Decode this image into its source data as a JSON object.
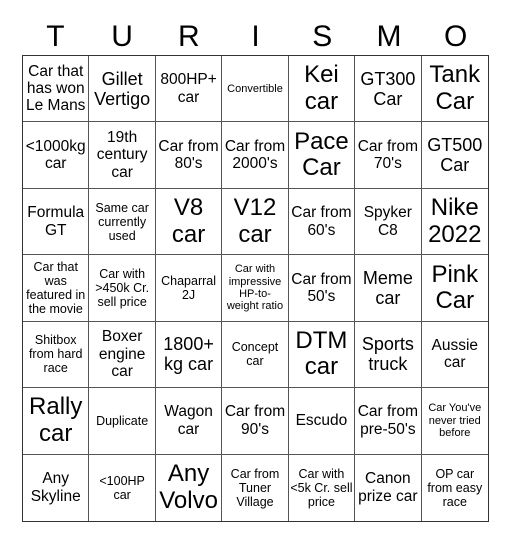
{
  "title_letters": [
    "T",
    "U",
    "R",
    "I",
    "S",
    "M",
    "O"
  ],
  "cells": [
    {
      "text": "Car that has won Le Mans",
      "size": "s-m"
    },
    {
      "text": "Gillet Vertigo",
      "size": "s-l"
    },
    {
      "text": "800HP+ car",
      "size": "s-m"
    },
    {
      "text": "Convertible",
      "size": "s-xs"
    },
    {
      "text": "Kei car",
      "size": "s-xl"
    },
    {
      "text": "GT300 Car",
      "size": "s-l"
    },
    {
      "text": "Tank Car",
      "size": "s-xl"
    },
    {
      "text": "<1000kg car",
      "size": "s-m"
    },
    {
      "text": "19th century car",
      "size": "s-m"
    },
    {
      "text": "Car from 80's",
      "size": "s-m"
    },
    {
      "text": "Car from 2000's",
      "size": "s-m"
    },
    {
      "text": "Pace Car",
      "size": "s-xl"
    },
    {
      "text": "Car from 70's",
      "size": "s-m"
    },
    {
      "text": "GT500 Car",
      "size": "s-l"
    },
    {
      "text": "Formula GT",
      "size": "s-m"
    },
    {
      "text": "Same car currently used",
      "size": "s-s"
    },
    {
      "text": "V8 car",
      "size": "s-xl"
    },
    {
      "text": "V12 car",
      "size": "s-xl"
    },
    {
      "text": "Car from 60's",
      "size": "s-m"
    },
    {
      "text": "Spyker C8",
      "size": "s-m"
    },
    {
      "text": "Nike 2022",
      "size": "s-xl"
    },
    {
      "text": "Car that was featured in the movie",
      "size": "s-s"
    },
    {
      "text": "Car with >450k Cr. sell price",
      "size": "s-s"
    },
    {
      "text": "Chaparral 2J",
      "size": "s-s"
    },
    {
      "text": "Car with impressive HP-to-weight ratio",
      "size": "s-xs"
    },
    {
      "text": "Car from 50's",
      "size": "s-m"
    },
    {
      "text": "Meme car",
      "size": "s-l"
    },
    {
      "text": "Pink Car",
      "size": "s-xl"
    },
    {
      "text": "Shitbox from hard race",
      "size": "s-s"
    },
    {
      "text": "Boxer engine car",
      "size": "s-m"
    },
    {
      "text": "1800+ kg car",
      "size": "s-l"
    },
    {
      "text": "Concept car",
      "size": "s-s"
    },
    {
      "text": "DTM car",
      "size": "s-xl"
    },
    {
      "text": "Sports truck",
      "size": "s-l"
    },
    {
      "text": "Aussie car",
      "size": "s-m"
    },
    {
      "text": "Rally car",
      "size": "s-xl"
    },
    {
      "text": "Duplicate",
      "size": "s-s"
    },
    {
      "text": "Wagon car",
      "size": "s-m"
    },
    {
      "text": "Car from 90's",
      "size": "s-m"
    },
    {
      "text": "Escudo",
      "size": "s-m"
    },
    {
      "text": "Car from pre-50's",
      "size": "s-m"
    },
    {
      "text": "Car You've never tried before",
      "size": "s-xs"
    },
    {
      "text": "Any Skyline",
      "size": "s-m"
    },
    {
      "text": "<100HP car",
      "size": "s-s"
    },
    {
      "text": "Any Volvo",
      "size": "s-xl"
    },
    {
      "text": "Car from Tuner Village",
      "size": "s-s"
    },
    {
      "text": "Car with <5k Cr. sell price",
      "size": "s-s"
    },
    {
      "text": "Canon prize car",
      "size": "s-m"
    },
    {
      "text": "OP car from easy race",
      "size": "s-s"
    }
  ]
}
